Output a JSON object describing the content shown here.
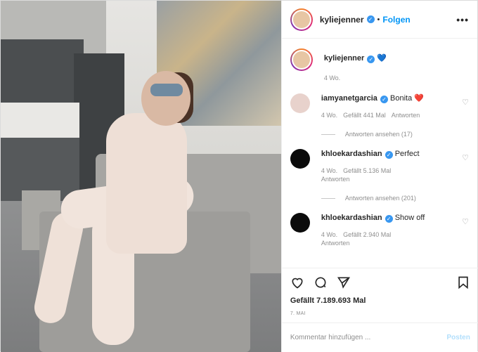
{
  "header": {
    "username": "kyliejenner",
    "dot": "•",
    "follow_label": "Folgen",
    "more": "•••"
  },
  "caption": {
    "username": "kyliejenner",
    "emoji": "💙",
    "time": "4 Wo."
  },
  "comments": [
    {
      "username": "iamyanetgarcia",
      "text": "Bonita",
      "emoji": "❤️",
      "time": "4 Wo.",
      "likes": "Gefällt 441 Mal",
      "reply": "Antworten",
      "view_replies": "Antworten ansehen (17)"
    },
    {
      "username": "khloekardashian",
      "text": "Perfect",
      "time": "4 Wo.",
      "likes": "Gefällt 5.136 Mal",
      "reply": "Antworten",
      "view_replies": "Antworten ansehen (201)"
    },
    {
      "username": "khloekardashian",
      "text": "Show off",
      "time": "4 Wo.",
      "likes": "Gefällt 2.940 Mal",
      "reply": "Antworten"
    }
  ],
  "likes": "Gefällt 7.189.693 Mal",
  "date": "7. MAI",
  "add_comment": {
    "placeholder": "Kommentar hinzufügen ...",
    "post_label": "Posten"
  },
  "colors": {
    "link": "#0095f6",
    "verified": "#3897f0",
    "muted": "#8e8e8e",
    "post_disabled": "#b2dffc"
  },
  "icons": [
    "verified-badge-icon",
    "more-icon",
    "heart-icon",
    "comment-icon",
    "share-icon",
    "bookmark-icon"
  ]
}
